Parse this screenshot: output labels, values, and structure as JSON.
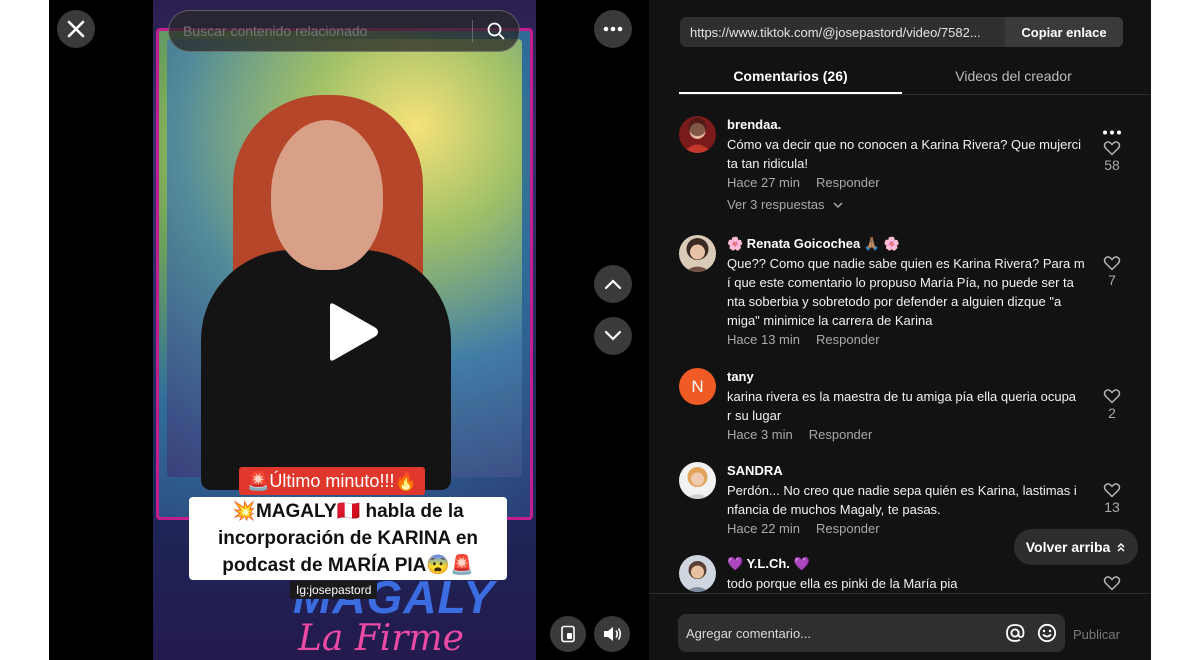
{
  "player": {
    "search_placeholder": "Buscar contenido relacionado",
    "caption_tag": "🚨Último minuto!!!🔥",
    "caption_lines": [
      "💥MAGALY🇵🇪 habla de la",
      "incorporación de KARINA en",
      "podcast de MARÍA PIA😨🚨"
    ],
    "handle": "Ig:josepastord",
    "bg_text_a": "MAGALY",
    "bg_text_b": "La Firme",
    "bg_text_c": "MA"
  },
  "panel": {
    "url": "https://www.tiktok.com/@josepastord/video/7582...",
    "copy_label": "Copiar enlace",
    "tabs": [
      {
        "label": "Comentarios (26)",
        "active": true
      },
      {
        "label": "Videos del creador",
        "active": false
      }
    ],
    "comments": [
      {
        "user": "brendaa.",
        "text_lines": [
          "Cómo va decir que no conocen a Karina Rivera? Que mujerci",
          "ta tan ridicula!"
        ],
        "time": "Hace 27 min",
        "reply": "Responder",
        "likes": "58",
        "replies": "Ver 3 respuestas"
      },
      {
        "user": "🌸 Renata Goicochea 🙏🏽 🌸",
        "text_lines": [
          "Que?? Como que nadie sabe quien es Karina Rivera? Para m",
          "í que este comentario lo propuso María Pía, no puede ser ta",
          "nta soberbia y sobretodo por defender a alguien dizque \"a",
          "miga\" minimice la carrera de Karina"
        ],
        "time": "Hace 13 min",
        "reply": "Responder",
        "likes": "7"
      },
      {
        "user": "tany",
        "avatar_letter": "N",
        "text_lines": [
          "karina rivera es la maestra de tu amiga pía ella queria ocupa",
          "r su lugar"
        ],
        "time": "Hace 3 min",
        "reply": "Responder",
        "likes": "2"
      },
      {
        "user": "SANDRA",
        "text_lines": [
          "Perdón... No creo que nadie sepa quién es Karina, lastimas i",
          "nfancia de muchos Magaly, te pasas."
        ],
        "time": "Hace 22 min",
        "reply": "Responder",
        "likes": "13"
      },
      {
        "user": "💜 Y.L.Ch. 💜",
        "text_lines": [
          "todo porque ella es pinki de la María pia"
        ],
        "time": "",
        "reply": "",
        "likes": ""
      }
    ],
    "back_to_top": "Volver arriba",
    "comment_placeholder": "Agregar comentario...",
    "publish_label": "Publicar"
  },
  "colors": {
    "accent_red": "#e0372c",
    "tany_avatar": "#f05a24"
  }
}
